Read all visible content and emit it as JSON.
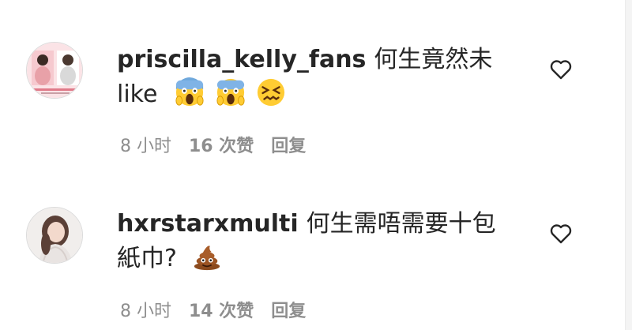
{
  "comments": [
    {
      "username": "priscilla_kelly_fans",
      "text_line1": "何生竟然未",
      "text_line2": "like",
      "emojis": [
        "scream-emoji",
        "scream-emoji",
        "confounded-emoji"
      ],
      "time": "8 小时",
      "likes": "16 次赞",
      "reply": "回复",
      "avatar_icon": "profile-photo-two-women",
      "like_icon": "heart-outline-icon"
    },
    {
      "username": "hxrstarxmulti",
      "text_line1": "何生需唔需要十包",
      "text_line2": "紙巾?",
      "emojis": [
        "poop-emoji"
      ],
      "time": "8 小时",
      "likes": "14 次赞",
      "reply": "回复",
      "avatar_icon": "profile-photo-woman",
      "like_icon": "heart-outline-icon"
    }
  ],
  "colors": {
    "text": "#262626",
    "meta": "#8e8e8e",
    "border": "#dbdbdb"
  }
}
